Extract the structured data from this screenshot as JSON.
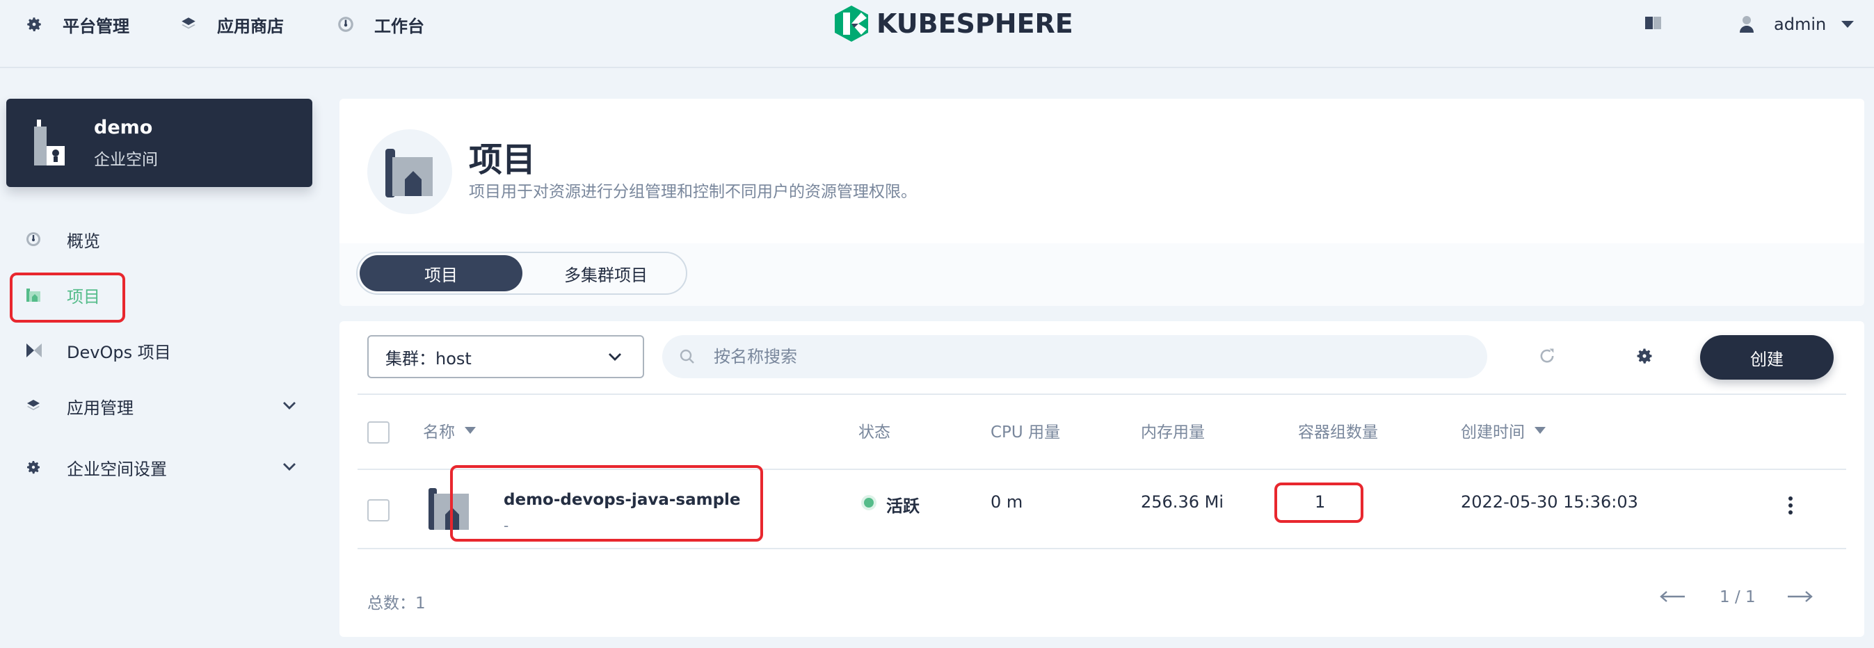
{
  "topnav": {
    "platform": "平台管理",
    "appstore": "应用商店",
    "workbench": "工作台",
    "logo_text": "KUBESPHERE",
    "user": "admin"
  },
  "workspace": {
    "name": "demo",
    "type": "企业空间"
  },
  "sidebar": {
    "items": [
      {
        "label": "概览",
        "icon": "dashboard-icon"
      },
      {
        "label": "项目",
        "icon": "project-icon",
        "active": true
      },
      {
        "label": "DevOps 项目",
        "icon": "devops-icon"
      },
      {
        "label": "应用管理",
        "icon": "layers-icon",
        "expandable": true
      },
      {
        "label": "企业空间设置",
        "icon": "gear-icon",
        "expandable": true
      }
    ]
  },
  "banner": {
    "title": "项目",
    "description": "项目用于对资源进行分组管理和控制不同用户的资源管理权限。"
  },
  "tabs": [
    "项目",
    "多集群项目"
  ],
  "toolbar": {
    "cluster_label": "集群：host",
    "search_placeholder": "按名称搜索",
    "create_label": "创建"
  },
  "table": {
    "columns": [
      "名称",
      "状态",
      "CPU 用量",
      "内存用量",
      "容器组数量",
      "创建时间"
    ],
    "rows": [
      {
        "name": "demo-devops-java-sample",
        "description": "-",
        "status": "活跃",
        "cpu": "0 m",
        "memory": "256.36 Mi",
        "pods": "1",
        "created": "2022-05-30 15:36:03"
      }
    ]
  },
  "footer": {
    "total": "总数：1",
    "page": "1 / 1"
  },
  "colors": {
    "accent": "#55bc8a",
    "dark": "#242e42",
    "highlight": "#e8272e"
  }
}
